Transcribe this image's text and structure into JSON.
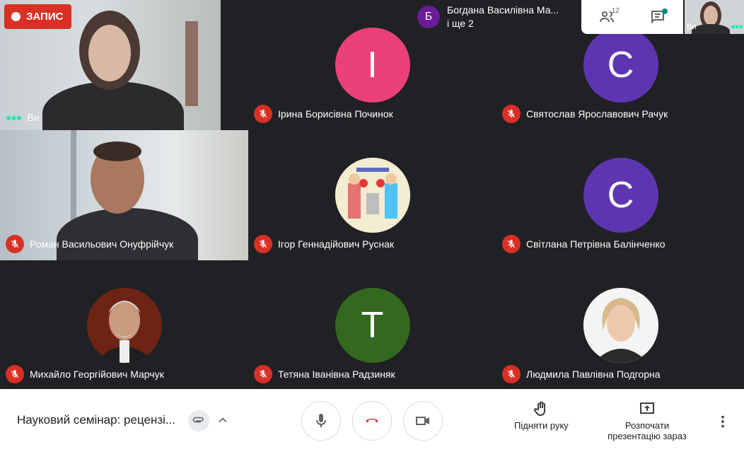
{
  "recording": {
    "label": "ЗАПИС"
  },
  "self_tile": {
    "name": "Ви"
  },
  "tiles": [
    {
      "name": "Ірина Борисівна Починок",
      "initial": "І",
      "color": "#ec407a"
    },
    {
      "name": "Святослав Ярославович Рачук",
      "initial": "С",
      "color": "#5e35b1"
    },
    {
      "name": "Роман Васильович Онуфрійчук"
    },
    {
      "name": "Ігор Геннадійович Руснак"
    },
    {
      "name": "Світлана Петрівна Балінченко",
      "initial": "С",
      "color": "#5e35b1"
    },
    {
      "name": "Михайло Георгійович Марчук"
    },
    {
      "name": "Тетяна Іванівна Радзиняк",
      "initial": "Т",
      "color": "#33691e"
    },
    {
      "name": "Людмила Павлівна Подгорна"
    }
  ],
  "top_bar": {
    "chip_initial": "Б",
    "chip_line1": "Богдана Василівна Ма...",
    "chip_line2": "і ще 2",
    "people_count": "12",
    "self_mini_label": "Ви"
  },
  "bottom_bar": {
    "meeting_title": "Науковий семінар: рецензі...",
    "raise_hand": "Підняти руку",
    "present_line1": "Розпочати",
    "present_line2": "презентацію зараз"
  }
}
